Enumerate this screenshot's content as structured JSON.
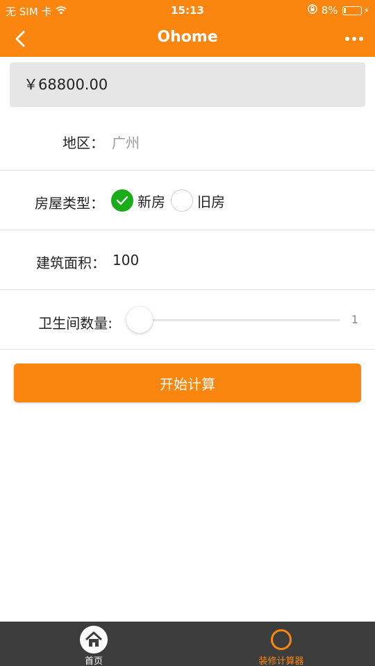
{
  "status_bar": {
    "carrier": "无 SIM 卡",
    "time": "15:13",
    "battery": "8%"
  },
  "nav": {
    "title": "Ohome"
  },
  "price": {
    "value": "￥68800.00"
  },
  "form": {
    "region": {
      "label": "地区：",
      "value": "广州"
    },
    "house_type": {
      "label": "房屋类型：",
      "options": [
        {
          "label": "新房",
          "checked": true
        },
        {
          "label": "旧房",
          "checked": false
        }
      ]
    },
    "area": {
      "label": "建筑面积：",
      "value": "100"
    },
    "bathrooms": {
      "label": "卫生间数量:",
      "value": "1",
      "level": 0
    }
  },
  "actions": {
    "start_label": "开始计算"
  },
  "tabbar": {
    "items": [
      {
        "label": "首页",
        "icon": "home-icon",
        "active": false
      },
      {
        "label": "装修计算器",
        "icon": "calculator-icon",
        "active": true
      }
    ]
  },
  "colors": {
    "brand": "#fb860f",
    "checked": "#1aad19",
    "tabbar": "#3d3d3d"
  }
}
